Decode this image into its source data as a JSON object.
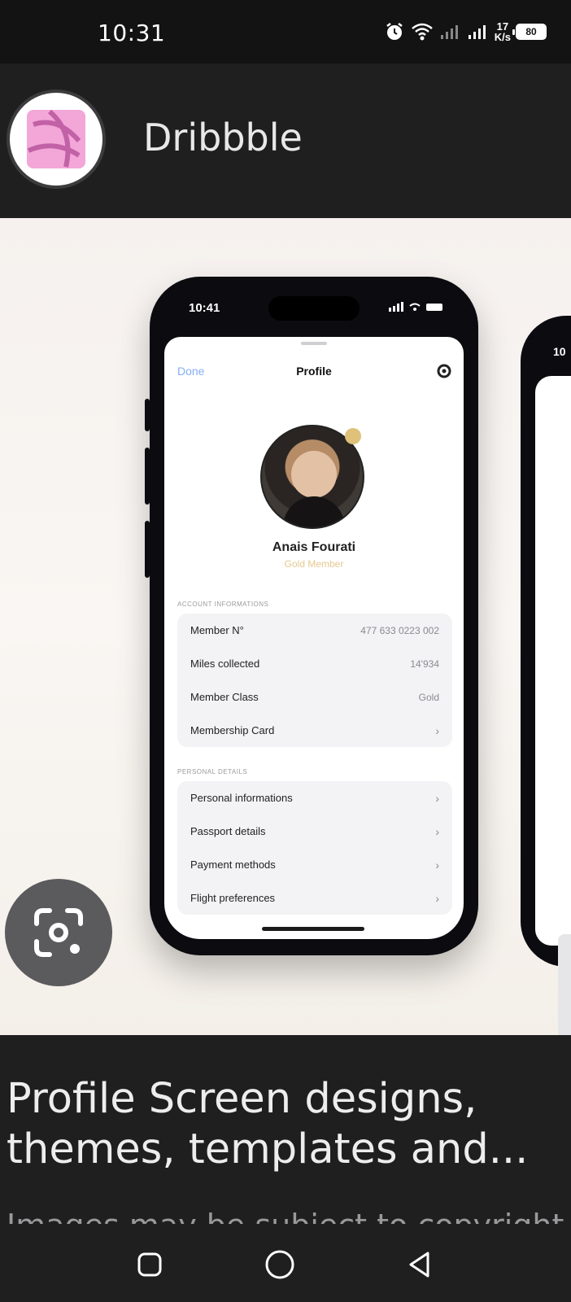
{
  "status_bar": {
    "time": "10:31",
    "net_speed_value": "17",
    "net_speed_unit": "K/s",
    "battery": "80",
    "icons": [
      "alarm-icon",
      "wifi-icon",
      "signal-icon",
      "signal-icon"
    ]
  },
  "header": {
    "app_name": "Dribbble",
    "logo_icon": "dribbble-logo-icon",
    "logo_color": "#f3a6d8"
  },
  "preview": {
    "phone": {
      "time": "10:41",
      "nav": {
        "done": "Done",
        "title": "Profile"
      },
      "name": "Anais Fourati",
      "subtitle": "Gold Member",
      "section_account": "ACCOUNT INFORMATIONS",
      "account_rows": [
        {
          "label": "Member N°",
          "value": "477 633 0223 002"
        },
        {
          "label": "Miles collected",
          "value": "14'934"
        },
        {
          "label": "Member Class",
          "value": "Gold"
        },
        {
          "label": "Membership Card",
          "value": "›"
        }
      ],
      "section_personal": "PERSONAL DETAILS",
      "personal_rows": [
        {
          "label": "Personal informations",
          "value": "›"
        },
        {
          "label": "Passport details",
          "value": "›"
        },
        {
          "label": "Payment methods",
          "value": "›"
        },
        {
          "label": "Flight preferences",
          "value": "›"
        }
      ]
    },
    "phone2": {
      "time": "10"
    }
  },
  "lens_button": {
    "icon": "lens-camera-icon"
  },
  "result": {
    "title": "Profile Screen designs, themes, templates and...",
    "copyright": "Images may be subject to copyright"
  },
  "nav_bar": {
    "recents": "recents-square-icon",
    "home": "home-circle-icon",
    "back": "back-triangle-icon"
  }
}
